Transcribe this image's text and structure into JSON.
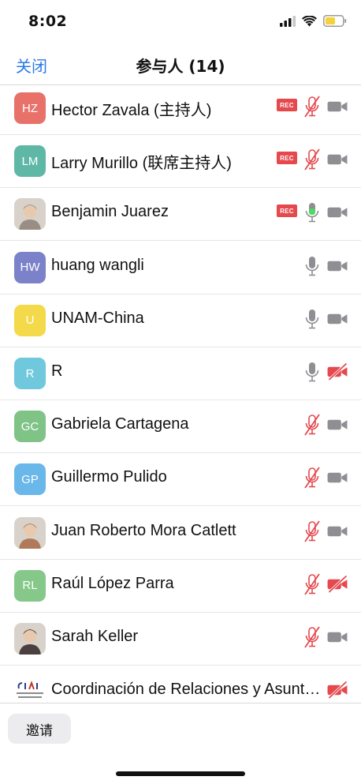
{
  "status_bar": {
    "time": "8:02",
    "icons": [
      "signal-icon",
      "wifi-icon",
      "battery-icon"
    ],
    "battery_color": "#f5d13a"
  },
  "nav": {
    "close_label": "关闭",
    "title": "参与人 (14)"
  },
  "colors": {
    "accent": "#2d7be5",
    "recording_red": "#e5484d",
    "muted_red": "#e5484d",
    "active_green": "#4cd964",
    "icon_gray": "#8e8e93"
  },
  "participants": [
    {
      "name": "Hector Zavala (主持人)",
      "initials": "HZ",
      "avatar_color": "#e8716a",
      "avatar_type": "initials",
      "recording": true,
      "mic": "muted",
      "video": "on"
    },
    {
      "name": "Larry Murillo (联席主持人)",
      "initials": "LM",
      "avatar_color": "#5fb8a6",
      "avatar_type": "initials",
      "recording": true,
      "mic": "muted",
      "video": "on"
    },
    {
      "name": "Benjamin Juarez",
      "initials": "",
      "avatar_color": "#9a8e84",
      "avatar_type": "photo",
      "recording": true,
      "mic": "active",
      "video": "on"
    },
    {
      "name": "huang wangli",
      "initials": "HW",
      "avatar_color": "#7b82c9",
      "avatar_type": "initials",
      "recording": false,
      "mic": "on",
      "video": "on"
    },
    {
      "name": "UNAM-China",
      "initials": "U",
      "avatar_color": "#f4d94a",
      "avatar_type": "initials",
      "recording": false,
      "mic": "on",
      "video": "on"
    },
    {
      "name": "R",
      "initials": "R",
      "avatar_color": "#6fc8dc",
      "avatar_type": "initials",
      "recording": false,
      "mic": "on",
      "video": "off"
    },
    {
      "name": "Gabriela Cartagena",
      "initials": "GC",
      "avatar_color": "#7fc387",
      "avatar_type": "initials",
      "recording": false,
      "mic": "muted",
      "video": "on"
    },
    {
      "name": "Guillermo Pulido",
      "initials": "GP",
      "avatar_color": "#6ab7ea",
      "avatar_type": "initials",
      "recording": false,
      "mic": "muted",
      "video": "on"
    },
    {
      "name": "Juan Roberto Mora Catlett",
      "initials": "",
      "avatar_color": "#b07a5a",
      "avatar_type": "photo",
      "recording": false,
      "mic": "muted",
      "video": "on"
    },
    {
      "name": "Raúl López Parra",
      "initials": "RL",
      "avatar_color": "#86c88a",
      "avatar_type": "initials",
      "recording": false,
      "mic": "muted",
      "video": "off"
    },
    {
      "name": "Sarah Keller",
      "initials": "",
      "avatar_color": "#4a4040",
      "avatar_type": "photo",
      "recording": false,
      "mic": "muted",
      "video": "on"
    },
    {
      "name": "Coordinación de Relaciones y Asuntos Internacionales",
      "initials": "CRAI",
      "avatar_color": "#ffffff",
      "avatar_type": "logo",
      "recording": false,
      "mic": "none",
      "video": "off"
    }
  ],
  "rec_label": "REC",
  "bottom": {
    "invite_label": "邀请"
  }
}
